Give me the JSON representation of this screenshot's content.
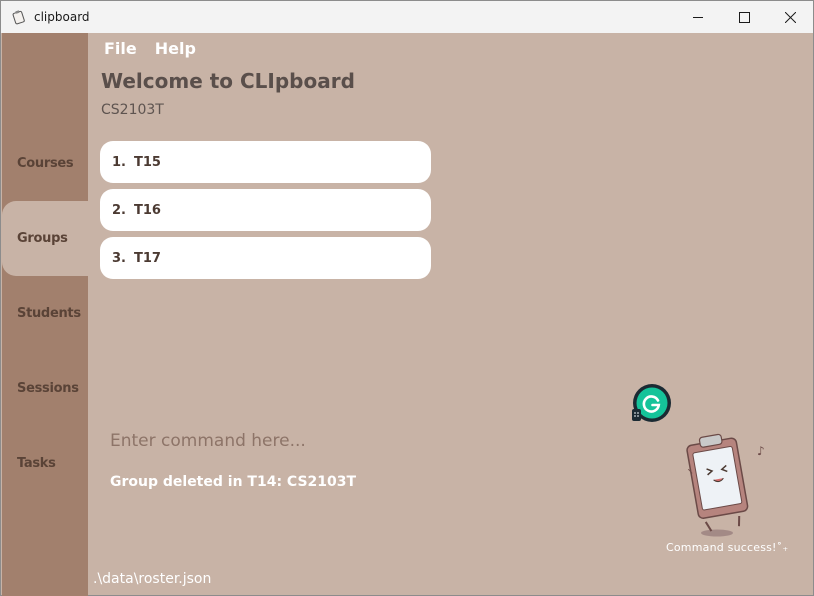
{
  "window": {
    "title": "clipboard",
    "controls": [
      "minimize",
      "maximize",
      "close"
    ]
  },
  "menubar": {
    "items": [
      "File",
      "Help"
    ]
  },
  "sidebar": {
    "items": [
      {
        "label": "Courses",
        "active": false
      },
      {
        "label": "Groups",
        "active": true
      },
      {
        "label": "Students",
        "active": false
      },
      {
        "label": "Sessions",
        "active": false
      },
      {
        "label": "Tasks",
        "active": false
      }
    ]
  },
  "main": {
    "title": "Welcome to CLIpboard",
    "subtitle": "CS2103T",
    "groups": [
      {
        "index": "1.",
        "name": "T15"
      },
      {
        "index": "2.",
        "name": "T16"
      },
      {
        "index": "3.",
        "name": "T17"
      }
    ]
  },
  "command": {
    "placeholder": "Enter command here...",
    "value": "",
    "result": "Group deleted in T14: CS2103T"
  },
  "mascot": {
    "caption": "Command success!˚₊"
  },
  "status": {
    "file_path": ".\\data\\roster.json"
  },
  "colors": {
    "sidebar": "#a2806d",
    "content": "#c8b3a6",
    "card": "#ffffff",
    "grammarly_accent": "#15c39a"
  }
}
